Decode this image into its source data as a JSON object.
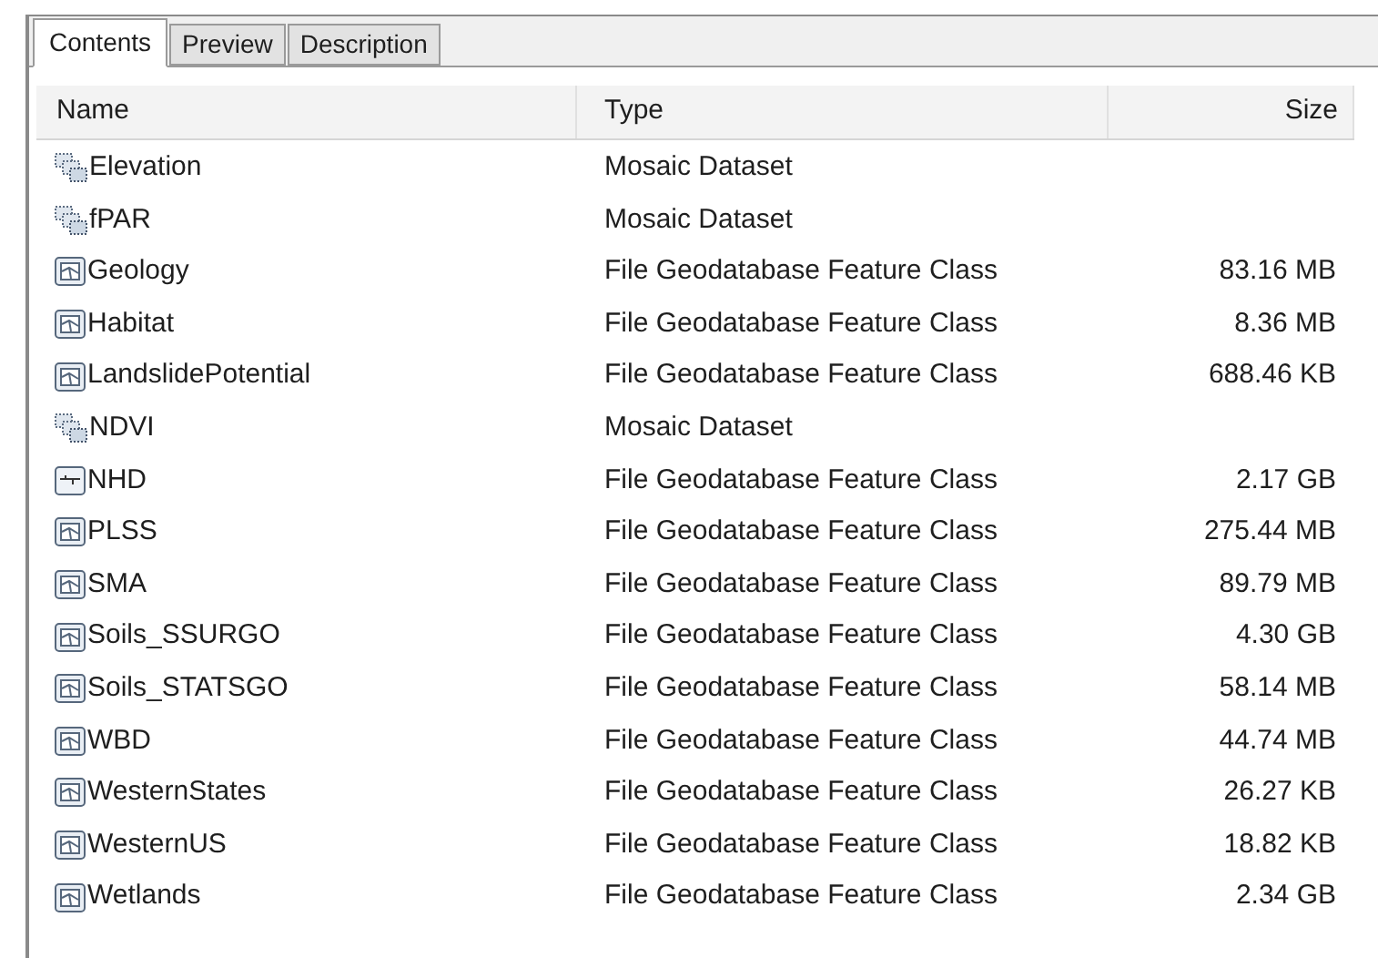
{
  "tabs": [
    {
      "label": "Contents",
      "selected": true
    },
    {
      "label": "Preview",
      "selected": false
    },
    {
      "label": "Description",
      "selected": false
    }
  ],
  "table": {
    "columns": [
      "Name",
      "Type",
      "Size"
    ],
    "rows": [
      {
        "kind": "mosaic",
        "name": "Elevation",
        "type": "Mosaic Dataset"
      },
      {
        "kind": "mosaic",
        "name": "fPAR",
        "type": "Mosaic Dataset"
      },
      {
        "kind": "polygon",
        "name": "Geology",
        "type": "File Geodatabase Feature Class",
        "size": "83.16 MB"
      },
      {
        "kind": "polygon",
        "name": "Habitat",
        "type": "File Geodatabase Feature Class",
        "size": "8.36 MB"
      },
      {
        "kind": "polygon",
        "name": "LandslidePotential",
        "type": "File Geodatabase Feature Class",
        "size": "688.46 KB"
      },
      {
        "kind": "mosaic",
        "name": "NDVI",
        "type": "Mosaic Dataset"
      },
      {
        "kind": "line",
        "name": "NHD",
        "type": "File Geodatabase Feature Class",
        "size": "2.17 GB"
      },
      {
        "kind": "polygon",
        "name": "PLSS",
        "type": "File Geodatabase Feature Class",
        "size": "275.44 MB"
      },
      {
        "kind": "polygon",
        "name": "SMA",
        "type": "File Geodatabase Feature Class",
        "size": "89.79 MB"
      },
      {
        "kind": "polygon",
        "name": "Soils_SSURGO",
        "type": "File Geodatabase Feature Class",
        "size": "4.30 GB"
      },
      {
        "kind": "polygon",
        "name": "Soils_STATSGO",
        "type": "File Geodatabase Feature Class",
        "size": "58.14 MB"
      },
      {
        "kind": "polygon",
        "name": "WBD",
        "type": "File Geodatabase Feature Class",
        "size": "44.74 MB"
      },
      {
        "kind": "polygon",
        "name": "WesternStates",
        "type": "File Geodatabase Feature Class",
        "size": "26.27 KB"
      },
      {
        "kind": "polygon",
        "name": "WesternUS",
        "type": "File Geodatabase Feature Class",
        "size": "18.82 KB"
      },
      {
        "kind": "polygon",
        "name": "Wetlands",
        "type": "File Geodatabase Feature Class",
        "size": "2.34 GB"
      }
    ]
  }
}
